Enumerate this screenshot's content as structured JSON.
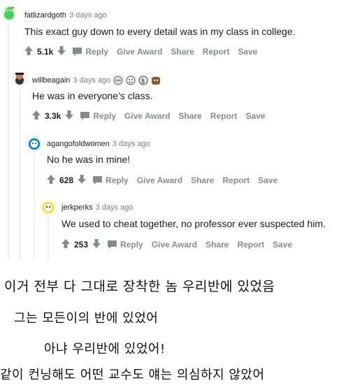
{
  "comments": [
    {
      "username": "fatlizardgoth",
      "time": "3 days ago",
      "text": "This exact guy down to every detail was in my class in college.",
      "votes": "5.1k",
      "avatar_icon": "snoo-green-avatar-icon"
    },
    {
      "username": "willbeagain",
      "time": "3 days ago",
      "text": "He was in everyone’s class.",
      "votes": "3.3k",
      "avatar_icon": "snoo-dark-avatar-icon",
      "awards": [
        "award-icon",
        "award-icon",
        "award-icon",
        "award-icon"
      ]
    },
    {
      "username": "agangofoldwomen",
      "time": "3 days ago",
      "text": "No he was in mine!",
      "votes": "628",
      "avatar_icon": "snoo-blue-avatar-icon"
    },
    {
      "username": "jerkperks",
      "time": "3 days ago",
      "text": "We used to cheat together, no professor ever suspected him.",
      "votes": "253",
      "avatar_icon": "snoo-yellow-avatar-icon"
    }
  ],
  "actions": {
    "reply": "Reply",
    "give_award": "Give Award",
    "share": "Share",
    "report": "Report",
    "save": "Save"
  },
  "translations": [
    "이거 전부 다 그대로 장착한 놈 우리반에 있었음",
    "그는 모든이의 반에 있었어",
    "아냐 우리반에 있었어!",
    "같이 컨닝해도 어떤 교수도 얘는 의심하지 않았어"
  ],
  "colors": {
    "accent_upvote": "#878a8c",
    "text": "#1a1a1b",
    "meta": "#7c7c7c",
    "thread_line": "#edeff1"
  }
}
